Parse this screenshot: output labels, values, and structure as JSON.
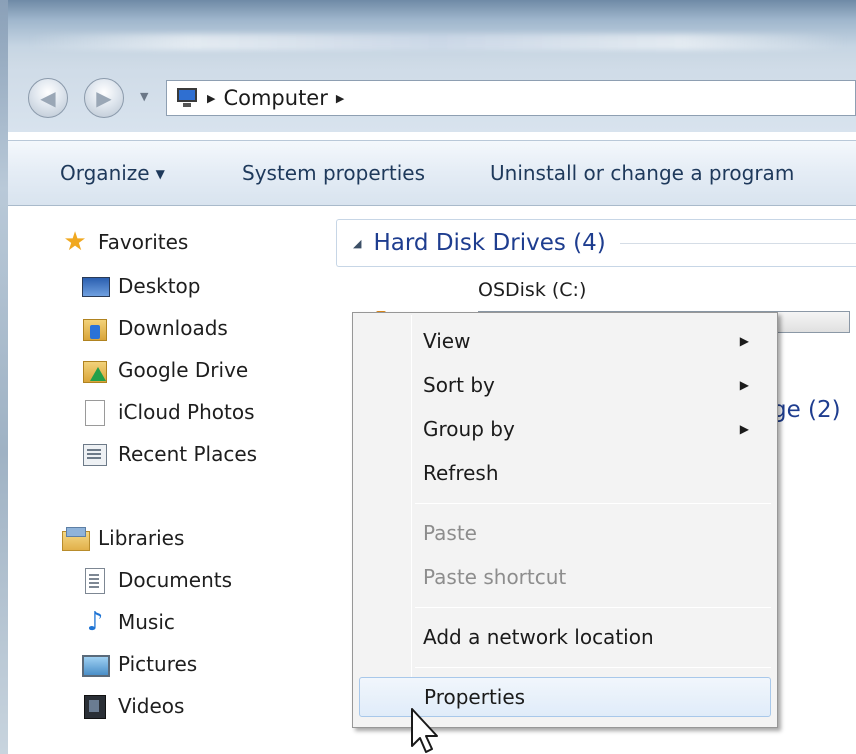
{
  "address": {
    "path": "Computer"
  },
  "toolbar": {
    "organize_label": "Organize",
    "system_properties_label": "System properties",
    "uninstall_label": "Uninstall or change a program"
  },
  "nav": {
    "favorites_label": "Favorites",
    "favorites_items": [
      {
        "label": "Desktop",
        "icon": "desktop-icon"
      },
      {
        "label": "Downloads",
        "icon": "downloads-folder-icon"
      },
      {
        "label": "Google Drive",
        "icon": "google-drive-folder-icon"
      },
      {
        "label": "iCloud Photos",
        "icon": "icloud-photos-icon"
      },
      {
        "label": "Recent Places",
        "icon": "recent-places-icon"
      }
    ],
    "libraries_label": "Libraries",
    "libraries_items": [
      {
        "label": "Documents",
        "icon": "documents-icon"
      },
      {
        "label": "Music",
        "icon": "music-icon"
      },
      {
        "label": "Pictures",
        "icon": "pictures-icon"
      },
      {
        "label": "Videos",
        "icon": "videos-icon"
      }
    ]
  },
  "content": {
    "group_title": "Hard Disk Drives (4)",
    "drive_name": "OSDisk (C:)",
    "drive_usage_fraction": 0.0,
    "group2_partial": "ge (2)"
  },
  "context_menu": {
    "items": [
      {
        "label": "View",
        "submenu": true,
        "disabled": false
      },
      {
        "label": "Sort by",
        "submenu": true,
        "disabled": false
      },
      {
        "label": "Group by",
        "submenu": true,
        "disabled": false
      },
      {
        "label": "Refresh",
        "submenu": false,
        "disabled": false
      },
      {
        "label": "Paste",
        "submenu": false,
        "disabled": true
      },
      {
        "label": "Paste shortcut",
        "submenu": false,
        "disabled": true
      },
      {
        "label": "Add a network location",
        "submenu": false,
        "disabled": false
      },
      {
        "label": "Properties",
        "submenu": false,
        "disabled": false,
        "highlighted": true
      }
    ]
  },
  "colors": {
    "link_blue": "#1e3d8f",
    "command_text": "#1e395b",
    "disabled_text": "#8d8d8d"
  }
}
